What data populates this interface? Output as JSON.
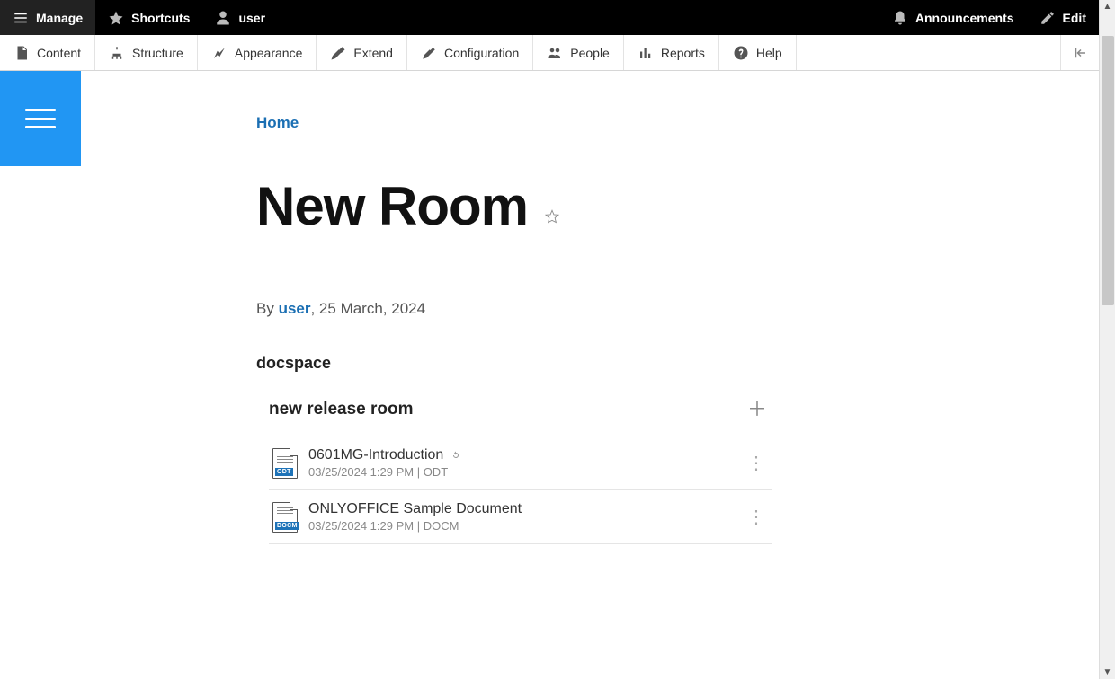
{
  "blackbar": {
    "manage": "Manage",
    "shortcuts": "Shortcuts",
    "user": "user",
    "announcements": "Announcements",
    "edit": "Edit"
  },
  "whitebar": {
    "content": "Content",
    "structure": "Structure",
    "appearance": "Appearance",
    "extend": "Extend",
    "configuration": "Configuration",
    "people": "People",
    "reports": "Reports",
    "help": "Help"
  },
  "breadcrumb": {
    "home": "Home"
  },
  "page": {
    "title": "New Room",
    "byline_prefix": "By ",
    "byline_user": "user",
    "byline_suffix": ", 25 March, 2024"
  },
  "docspace": {
    "label": "docspace",
    "room_name": "new release room",
    "files": [
      {
        "name": "0601MG-Introduction",
        "sub": "03/25/2024 1:29 PM  |  ODT",
        "ext": "ODT",
        "icon": "odt",
        "has_refresh": true
      },
      {
        "name": "ONLYOFFICE Sample Document",
        "sub": "03/25/2024 1:29 PM  |  DOCM",
        "ext": "DOCM",
        "icon": "docm",
        "has_refresh": false
      }
    ]
  }
}
